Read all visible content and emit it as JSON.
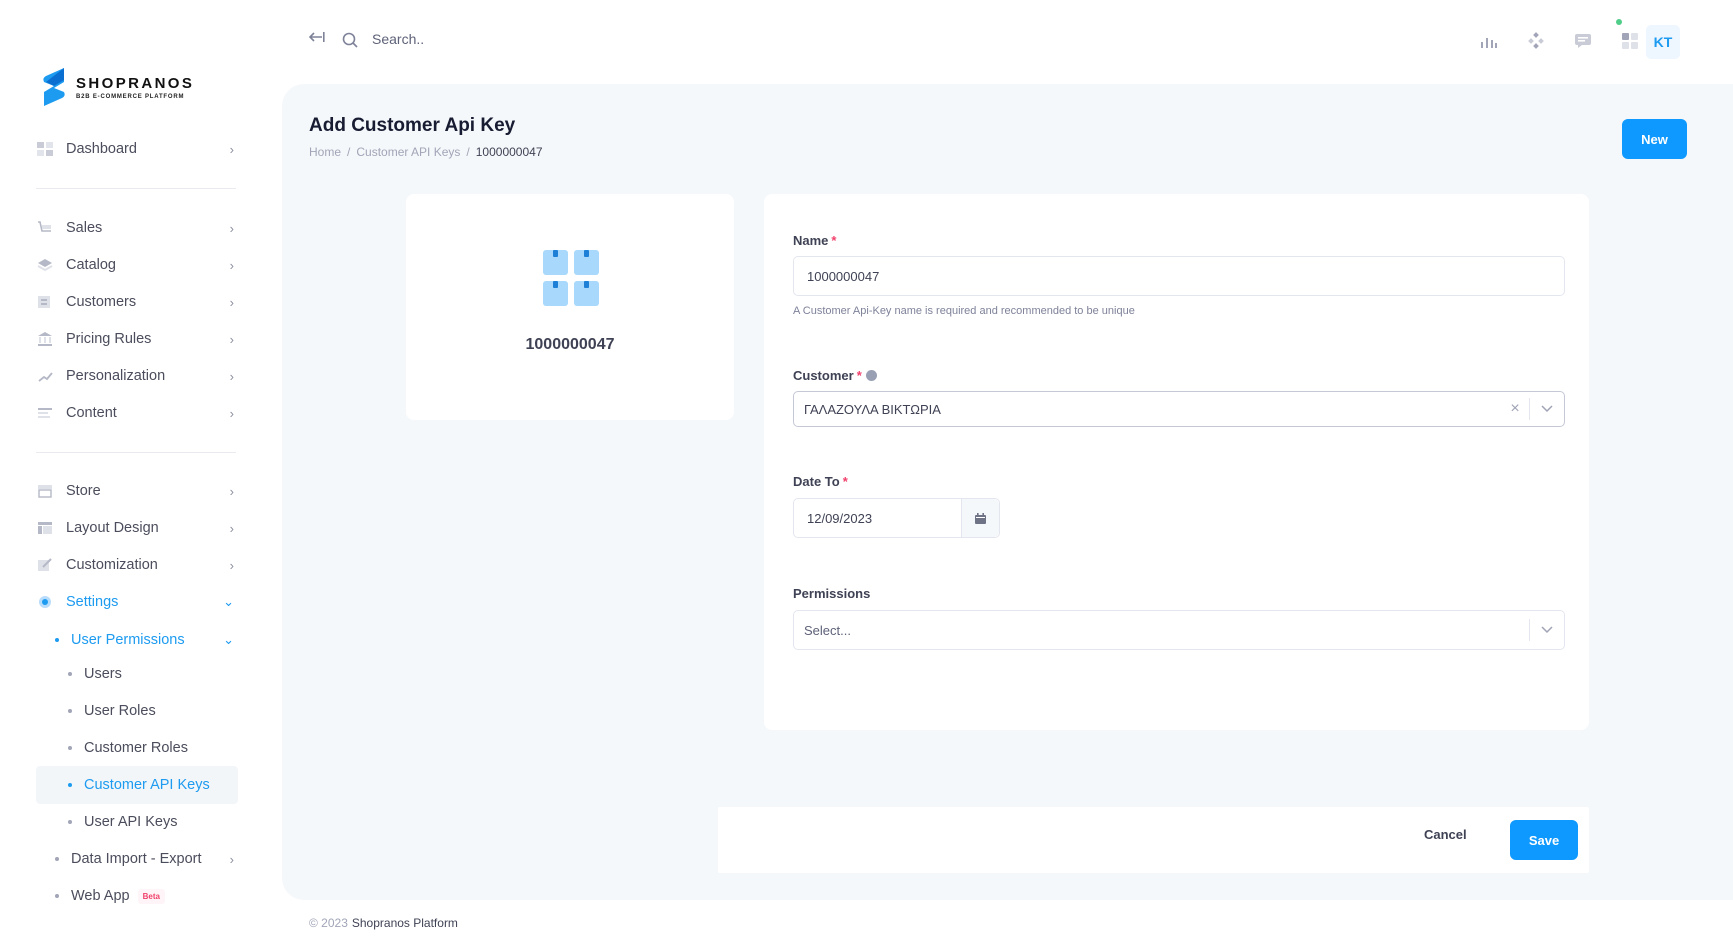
{
  "brand": {
    "name": "SHOPRANOS",
    "tagline": "B2B E-COMMERCE PLATFORM"
  },
  "header": {
    "search_placeholder": "Search..",
    "avatar_initials": "KT"
  },
  "sidebar": {
    "items": [
      {
        "label": "Dashboard",
        "icon": "dashboard-icon"
      },
      {
        "label": "Sales",
        "icon": "cart-icon"
      },
      {
        "label": "Catalog",
        "icon": "layers-icon"
      },
      {
        "label": "Customers",
        "icon": "address-book-icon"
      },
      {
        "label": "Pricing Rules",
        "icon": "bank-icon"
      },
      {
        "label": "Personalization",
        "icon": "chart-icon"
      },
      {
        "label": "Content",
        "icon": "text-icon"
      },
      {
        "label": "Store",
        "icon": "store-icon"
      },
      {
        "label": "Layout Design",
        "icon": "layout-icon"
      },
      {
        "label": "Customization",
        "icon": "edit-icon"
      },
      {
        "label": "Settings",
        "icon": "gear-icon"
      }
    ],
    "settings_sub": {
      "user_permissions": "User Permissions",
      "children": [
        "Users",
        "User Roles",
        "Customer Roles",
        "Customer API Keys",
        "User API Keys"
      ],
      "data_import_export": "Data Import - Export",
      "web_app": "Web App",
      "beta": "Beta"
    }
  },
  "page": {
    "title": "Add Customer Api Key",
    "breadcrumb": [
      "Home",
      "Customer API Keys",
      "1000000047"
    ],
    "new_button": "New"
  },
  "summary_card": {
    "key_name": "1000000047"
  },
  "form": {
    "name_label": "Name",
    "name_value": "1000000047",
    "name_hint": "A Customer Api-Key name is required and recommended to be unique",
    "customer_label": "Customer",
    "customer_value": "ΓΑΛΑΖΟΥΛΑ ΒΙΚΤΩΡΙΑ",
    "date_to_label": "Date To",
    "date_to_value": "12/09/2023",
    "permissions_label": "Permissions",
    "permissions_placeholder": "Select...",
    "required_mark": "*",
    "cancel_label": "Cancel",
    "save_label": "Save"
  },
  "footer": {
    "year": "© 2023",
    "brand": "Shopranos Platform"
  },
  "colors": {
    "accent": "#0d99ff",
    "required": "#f1416c",
    "panel_bg": "#f5f8fa"
  }
}
